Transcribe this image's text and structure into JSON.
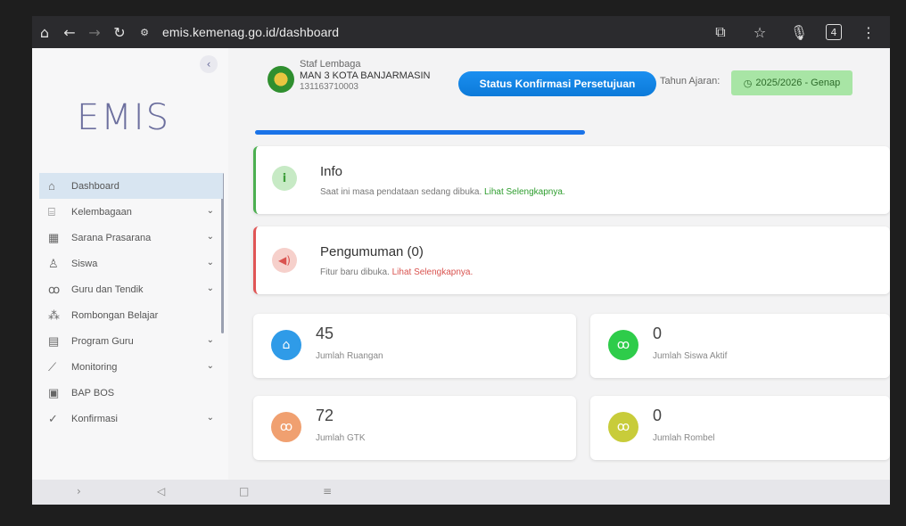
{
  "browser": {
    "url": "emis.kemenag.go.id/dashboard",
    "tab_count": "4"
  },
  "sidebar": {
    "logo": "EMIS",
    "items": [
      {
        "label": "Dashboard",
        "icon": "home-icon",
        "expandable": false,
        "active": true
      },
      {
        "label": "Kelembagaan",
        "icon": "institution-icon",
        "expandable": true,
        "active": false
      },
      {
        "label": "Sarana Prasarana",
        "icon": "building-icon",
        "expandable": true,
        "active": false
      },
      {
        "label": "Siswa",
        "icon": "user-icon",
        "expandable": true,
        "active": false
      },
      {
        "label": "Guru dan Tendik",
        "icon": "users-icon",
        "expandable": true,
        "active": false
      },
      {
        "label": "Rombongan Belajar",
        "icon": "group-icon",
        "expandable": false,
        "active": false
      },
      {
        "label": "Program Guru",
        "icon": "program-icon",
        "expandable": true,
        "active": false
      },
      {
        "label": "Monitoring",
        "icon": "chart-icon",
        "expandable": true,
        "active": false
      },
      {
        "label": "BAP BOS",
        "icon": "document-icon",
        "expandable": false,
        "active": false
      },
      {
        "label": "Konfirmasi",
        "icon": "check-icon",
        "expandable": true,
        "active": false
      }
    ]
  },
  "header": {
    "role": "Staf Lembaga",
    "school": "MAN 3 KOTA BANJARMASIN",
    "npsn": "131163710003",
    "status_button": "Status Konfirmasi Persetujuan",
    "tahun_label": "Tahun Ajaran:",
    "tahun_value": "2025/2026 - Genap"
  },
  "info": {
    "title": "Info",
    "desc": "Saat ini masa pendataan sedang dibuka.",
    "link": "Lihat Selengkapnya."
  },
  "announcement": {
    "title": "Pengumuman (0)",
    "desc": "Fitur baru dibuka.",
    "link": "Lihat Selengkapnya."
  },
  "stats": [
    {
      "value": "45",
      "label": "Jumlah Ruangan",
      "color": "#2f9be8"
    },
    {
      "value": "0",
      "label": "Jumlah Siswa Aktif",
      "color": "#2ecc4a"
    },
    {
      "value": "72",
      "label": "Jumlah GTK",
      "color": "#f0a070"
    },
    {
      "value": "0",
      "label": "Jumlah Rombel",
      "color": "#c8cc3a"
    }
  ]
}
